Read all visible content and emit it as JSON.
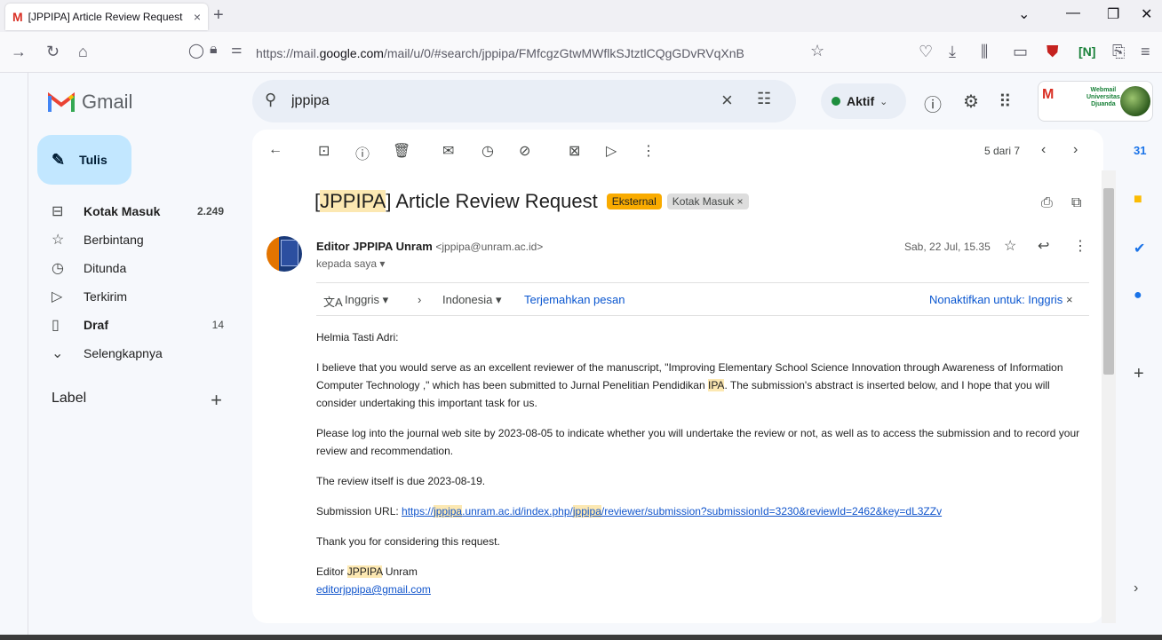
{
  "browser": {
    "tab_title": "[JPPIPA] Article Review Request",
    "tab_close": "×",
    "new_tab": "+",
    "url_prefix": "https://mail.",
    "url_domain": "google.com",
    "url_rest": "/mail/u/0/#search/jppipa/FMfcgzGtwMWflkSJtztlCQgGDvRVqXnB"
  },
  "gmail": {
    "app_name": "Gmail",
    "search_value": "jppipa",
    "status_label": "Aktif",
    "account_badge": {
      "line1": "Webmail",
      "line2": "Universitas",
      "line3": "Djuanda"
    },
    "compose_label": "Tulis",
    "sidebar": {
      "items": [
        {
          "label": "Kotak Masuk",
          "count": "2.249",
          "icon": "inbox-icon"
        },
        {
          "label": "Berbintang",
          "count": "",
          "icon": "star-icon"
        },
        {
          "label": "Ditunda",
          "count": "",
          "icon": "clock-icon"
        },
        {
          "label": "Terkirim",
          "count": "",
          "icon": "send-icon"
        },
        {
          "label": "Draf",
          "count": "14",
          "icon": "draft-icon"
        },
        {
          "label": "Selengkapnya",
          "count": "",
          "icon": "chevron-down-icon"
        }
      ],
      "labels_heading": "Label"
    },
    "pager": "5 dari 7",
    "message": {
      "subject_prefix": "[",
      "subject_highlight": "JPPIPA",
      "subject_rest": "] Article Review Request",
      "chip_external": "Eksternal",
      "chip_inbox": "Kotak Masuk",
      "chip_inbox_close": "×",
      "sender_name": "Editor JPPIPA Unram",
      "sender_email": "<jppipa@unram.ac.id>",
      "to_me": "kepada saya ▾",
      "date": "Sab, 22 Jul, 15.35",
      "translate": {
        "from_lang": "Inggris",
        "to_lang": "Indonesia",
        "translate_link": "Terjemahkan pesan",
        "disable_link": "Nonaktifkan untuk: Inggris"
      },
      "greeting": "Helmia Tasti Adri:",
      "para1_a": "I believe that you would serve as an excellent reviewer of the manuscript, \"Improving Elementary School Science Innovation through Awareness of Information Computer Technology ,\" which has been submitted to Jurnal Penelitian Pendidikan ",
      "para1_hl": "IPA",
      "para1_b": ". The submission's abstract is inserted below, and I hope that you will consider undertaking this important task for us.",
      "para2": "Please log into the journal web site by 2023-08-05 to indicate whether you will undertake the review or not, as well as to access the submission and to record your review and recommendation.",
      "para3": "The review itself is due 2023-08-19.",
      "submission_label": "Submission URL: ",
      "submission_url_a": "https://",
      "submission_url_hl1": "jppipa",
      "submission_url_b": ".unram.ac.id/index.php/",
      "submission_url_hl2": "jppipa",
      "submission_url_c": "/reviewer/submission?submissionId=3230&reviewId=2462&key=dL3ZZv",
      "para5": "Thank you for considering this request.",
      "sign_a": "Editor ",
      "sign_hl": "JPPIPA",
      "sign_b": " Unram",
      "sign_email": "editorjppipa@gmail.com"
    }
  },
  "colors": {
    "accent": "#c2e7ff",
    "highlight": "#fce8b2",
    "external_chip": "#f9ab00",
    "link": "#0b57d0"
  }
}
